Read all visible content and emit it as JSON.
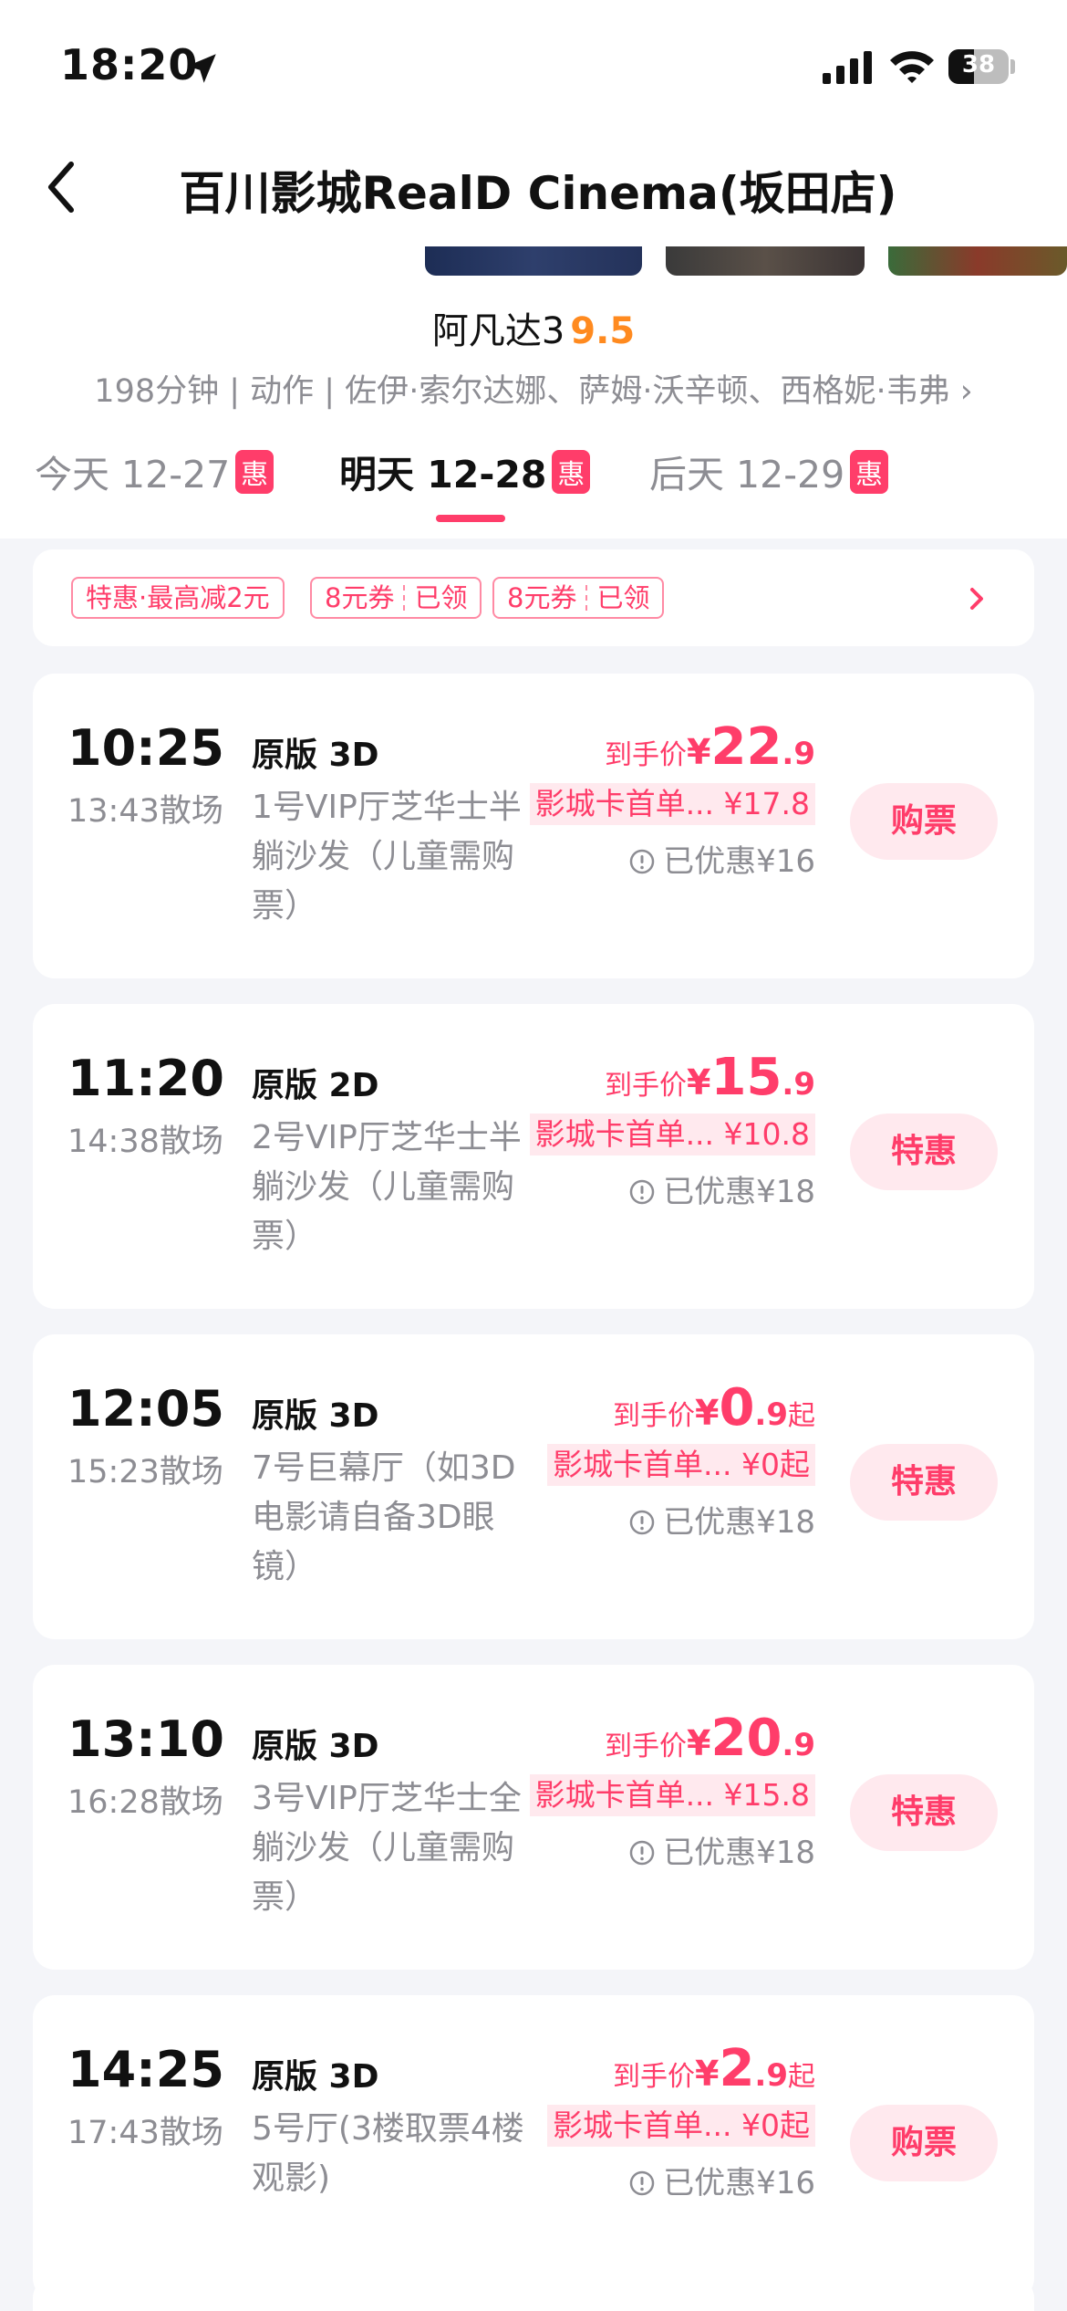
{
  "status_bar": {
    "time": "18:20",
    "battery": "38"
  },
  "nav": {
    "title": "百川影城RealD Cinema(坂田店)"
  },
  "movie": {
    "name": "阿凡达3",
    "score": "9.5",
    "meta": "198分钟 | 动作 | 佐伊·索尔达娜、萨姆·沃辛顿、西格妮·韦弗 ›"
  },
  "dates": [
    {
      "label": "今天 12-27",
      "badge": "惠"
    },
    {
      "label": "明天 12-28",
      "badge": "惠"
    },
    {
      "label": "后天 12-29",
      "badge": "惠"
    }
  ],
  "promos": [
    {
      "text": "特惠·最高减2元"
    },
    {
      "text": "8元券",
      "status": "已领"
    },
    {
      "text": "8元券",
      "status": "已领"
    }
  ],
  "colors": {
    "accent": "#ff3d6a",
    "score": "#ff8a1f",
    "muted": "#8d8d93"
  },
  "sessions": [
    {
      "start": "10:25",
      "end": "13:43散场",
      "type": "原版 3D",
      "hall": "1号VIP厅芝华士半躺沙发（儿童需购票）",
      "price_label": "到手价",
      "currency": "¥",
      "price_main": "22",
      "price_dec": ".9",
      "price_suffix": "",
      "card_price": "影城卡首单... ¥17.8",
      "saved": "已优惠¥16",
      "button": "购票"
    },
    {
      "start": "11:20",
      "end": "14:38散场",
      "type": "原版 2D",
      "hall": "2号VIP厅芝华士半躺沙发（儿童需购票）",
      "price_label": "到手价",
      "currency": "¥",
      "price_main": "15",
      "price_dec": ".9",
      "price_suffix": "",
      "card_price": "影城卡首单... ¥10.8",
      "saved": "已优惠¥18",
      "button": "特惠"
    },
    {
      "start": "12:05",
      "end": "15:23散场",
      "type": "原版 3D",
      "hall": "7号巨幕厅（如3D电影请自备3D眼镜）",
      "price_label": "到手价",
      "currency": "¥",
      "price_main": "0",
      "price_dec": ".9",
      "price_suffix": "起",
      "card_price": "影城卡首单... ¥0起",
      "saved": "已优惠¥18",
      "button": "特惠"
    },
    {
      "start": "13:10",
      "end": "16:28散场",
      "type": "原版 3D",
      "hall": "3号VIP厅芝华士全躺沙发（儿童需购票）",
      "price_label": "到手价",
      "currency": "¥",
      "price_main": "20",
      "price_dec": ".9",
      "price_suffix": "",
      "card_price": "影城卡首单... ¥15.8",
      "saved": "已优惠¥18",
      "button": "特惠"
    },
    {
      "start": "14:25",
      "end": "17:43散场",
      "type": "原版 3D",
      "hall": "5号厅(3楼取票4楼观影)",
      "price_label": "到手价",
      "currency": "¥",
      "price_main": "2",
      "price_dec": ".9",
      "price_suffix": "起",
      "card_price": "影城卡首单... ¥0起",
      "saved": "已优惠¥16",
      "button": "购票"
    }
  ]
}
